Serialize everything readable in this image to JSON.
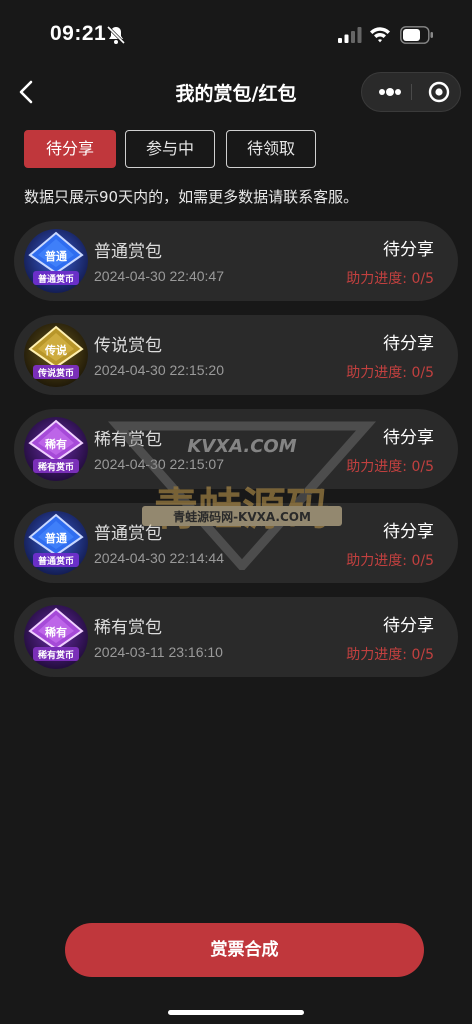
{
  "status_bar": {
    "time": "09:21"
  },
  "nav": {
    "title": "我的赏包/红包"
  },
  "tabs": [
    {
      "label": "待分享",
      "active": true
    },
    {
      "label": "参与中",
      "active": false
    },
    {
      "label": "待领取",
      "active": false
    }
  ],
  "notice": "数据只展示90天内的，如需更多数据请联系客服。",
  "items": [
    {
      "name": "普通赏包",
      "time": "2024-04-30 22:40:47",
      "status": "待分享",
      "progress": "助力进度: 0/5",
      "badge_top": "普通",
      "badge_bottom": "普通赏币",
      "badge_type": "common"
    },
    {
      "name": "传说赏包",
      "time": "2024-04-30 22:15:20",
      "status": "待分享",
      "progress": "助力进度: 0/5",
      "badge_top": "传说",
      "badge_bottom": "传说赏币",
      "badge_type": "legend"
    },
    {
      "name": "稀有赏包",
      "time": "2024-04-30 22:15:07",
      "status": "待分享",
      "progress": "助力进度: 0/5",
      "badge_top": "稀有",
      "badge_bottom": "稀有赏币",
      "badge_type": "rare"
    },
    {
      "name": "普通赏包",
      "time": "2024-04-30 22:14:44",
      "status": "待分享",
      "progress": "助力进度: 0/5",
      "badge_top": "普通",
      "badge_bottom": "普通赏币",
      "badge_type": "common"
    },
    {
      "name": "稀有赏包",
      "time": "2024-03-11 23:16:10",
      "status": "待分享",
      "progress": "助力进度: 0/5",
      "badge_top": "稀有",
      "badge_bottom": "稀有赏币",
      "badge_type": "rare"
    }
  ],
  "watermark": {
    "top": "KVXA.COM",
    "bottom": "青蛙源码",
    "banner": "青蛙源码网-KVXA.COM"
  },
  "merge_button": "赏票合成",
  "colors": {
    "accent": "#c0373c",
    "progress": "#c1403f",
    "card": "#2a2a2a",
    "background": "#181818"
  },
  "icons": {
    "back": "back-arrow-icon",
    "more": "more-dots-icon",
    "target": "target-icon",
    "bell": "bell-off-icon"
  }
}
